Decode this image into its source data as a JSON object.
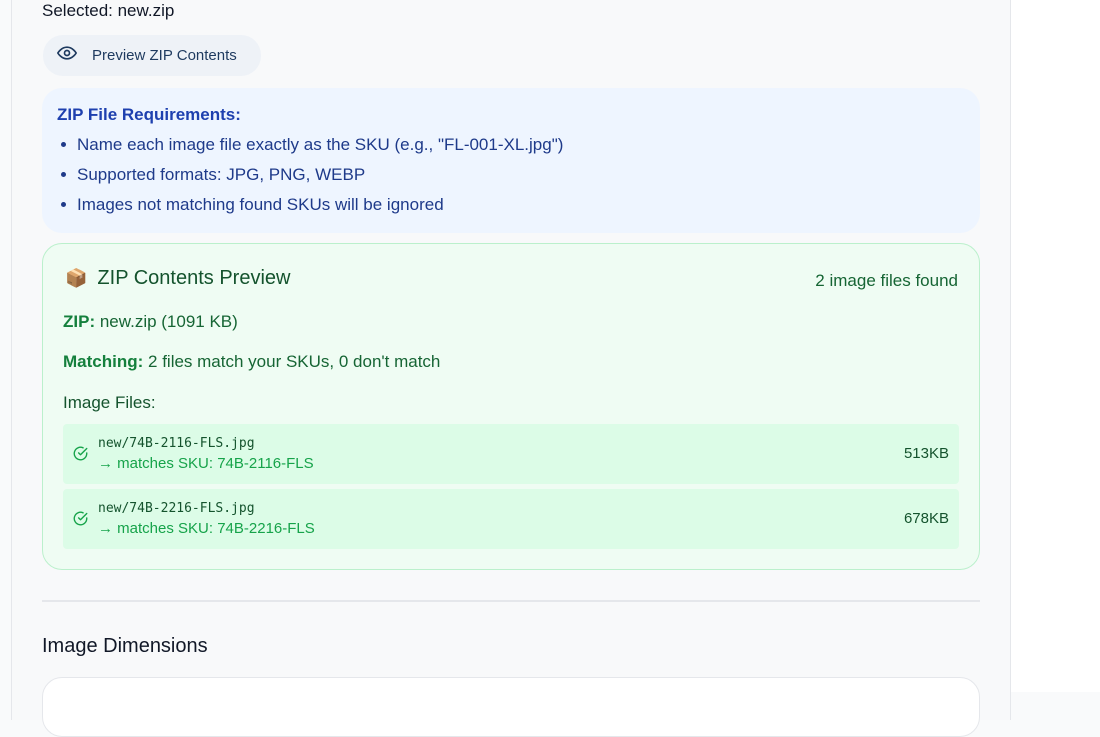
{
  "selected_text": "Selected: new.zip",
  "preview_button": {
    "label": "Preview ZIP Contents",
    "icon": "eye-icon"
  },
  "requirements": {
    "title": "ZIP File Requirements:",
    "items": [
      "Name each image file exactly as the SKU (e.g., \"FL-001-XL.jpg\")",
      "Supported formats: JPG, PNG, WEBP",
      "Images not matching found SKUs will be ignored"
    ]
  },
  "zip_preview": {
    "icon": "📦",
    "title": "ZIP Contents Preview",
    "count_text": "2 image files found",
    "zip_label": "ZIP:",
    "zip_value": "new.zip (1091 KB)",
    "matching_label": "Matching:",
    "matching_value": "2 files match your SKUs, 0 don't match",
    "files_label": "Image Files:",
    "files": [
      {
        "name": "new/74B-2116-FLS.jpg",
        "match": "→ matches SKU: 74B-2116-FLS",
        "size": "513KB"
      },
      {
        "name": "new/74B-2216-FLS.jpg",
        "match": "→ matches SKU: 74B-2216-FLS",
        "size": "678KB"
      }
    ]
  },
  "dimensions": {
    "title": "Image Dimensions"
  },
  "colors": {
    "blue_bg": "#eef5ff",
    "blue_text": "#1e3a8a",
    "green_bg": "#effcf3",
    "green_row": "#dcfce7",
    "green_text": "#166534"
  }
}
